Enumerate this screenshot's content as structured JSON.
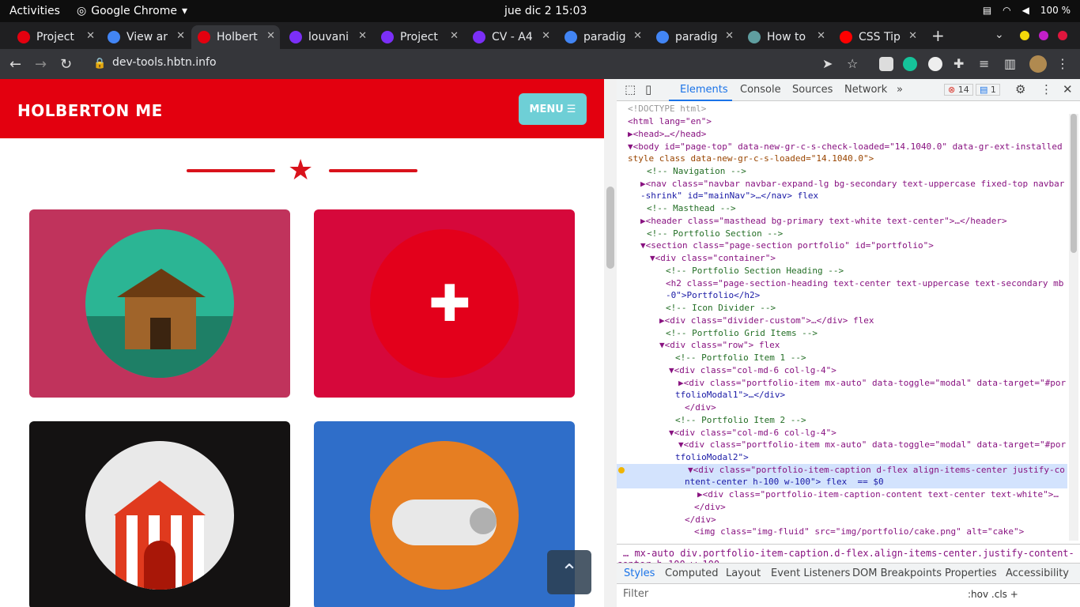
{
  "topbar": {
    "activities": "Activities",
    "app": "Google Chrome",
    "clock": "jue dic 2  15:03",
    "battery": "100 %"
  },
  "tabs": [
    {
      "title": "Project",
      "color": "#e3000f"
    },
    {
      "title": "View ar",
      "color": "#4285f4"
    },
    {
      "title": "Holbert",
      "color": "#e3000f"
    },
    {
      "title": "louvani",
      "color": "#7b2ff7"
    },
    {
      "title": "Project",
      "color": "#7b2ff7"
    },
    {
      "title": "CV - A4",
      "color": "#7b2ff7"
    },
    {
      "title": "paradig",
      "color": "#4285f4"
    },
    {
      "title": "paradig",
      "color": "#4285f4"
    },
    {
      "title": "How to",
      "color": "#5f9ea0"
    },
    {
      "title": "CSS Tip",
      "color": "#ff0000"
    }
  ],
  "browser": {
    "url": "dev-tools.hbtn.info",
    "new_tab": "+"
  },
  "site": {
    "brand": "HOLBERTON ME",
    "menu": "MENU",
    "backtop": "⌃"
  },
  "cards": [
    {
      "name": "cabin",
      "bg": "#c0335c",
      "circle": "#2bb594"
    },
    {
      "name": "cake",
      "bg": "#d6083b",
      "circle": "#e3001b"
    },
    {
      "name": "circus",
      "bg": "#141212",
      "circle": "#e9e9e9"
    },
    {
      "name": "game",
      "bg": "#2f6ec9",
      "circle": "#e67e22"
    }
  ],
  "devtools": {
    "tabs": [
      "Elements",
      "Console",
      "Sources",
      "Network",
      "»"
    ],
    "errors": "14",
    "messages": "1",
    "lines": [
      "<!DOCTYPE html>",
      "<html lang=\"en\">",
      "▶<head>…</head>",
      "▼<body id=\"page-top\" data-new-gr-c-s-check-loaded=\"14.1040.0\" data-gr-ext-installed",
      "style class data-new-gr-c-s-loaded=\"14.1040.0\">",
      "<!-- Navigation -->",
      "▶<nav class=\"navbar navbar-expand-lg bg-secondary text-uppercase fixed-top navbar",
      "-shrink\" id=\"mainNav\">…</nav> flex",
      "<!-- Masthead -->",
      "▶<header class=\"masthead bg-primary text-white text-center\">…</header>",
      "<!-- Portfolio Section -->",
      "▼<section class=\"page-section portfolio\" id=\"portfolio\">",
      "▼<div class=\"container\">",
      "<!-- Portfolio Section Heading -->",
      "<h2 class=\"page-section-heading text-center text-uppercase text-secondary mb",
      "-0\">Portfolio</h2>",
      "<!-- Icon Divider -->",
      "▶<div class=\"divider-custom\">…</div> flex",
      "<!-- Portfolio Grid Items -->",
      "▼<div class=\"row\"> flex",
      "<!-- Portfolio Item 1 -->",
      "▼<div class=\"col-md-6 col-lg-4\">",
      "▶<div class=\"portfolio-item mx-auto\" data-toggle=\"modal\" data-target=\"#por",
      "tfolioModal1\">…</div>",
      "</div>",
      "<!-- Portfolio Item 2 -->",
      "▼<div class=\"col-md-6 col-lg-4\">",
      "▼<div class=\"portfolio-item mx-auto\" data-toggle=\"modal\" data-target=\"#por",
      "tfolioModal2\">",
      "▼<div class=\"portfolio-item-caption d-flex align-items-center justify-co",
      "ntent-center h-100 w-100\"> flex  == $0",
      "▶<div class=\"portfolio-item-caption-content text-center text-white\">…",
      "</div>",
      "</div>",
      "<img class=\"img-fluid\" src=\"img/portfolio/cake.png\" alt=\"cake\">"
    ],
    "crumbs": "…  mx-auto    div.portfolio-item-caption.d-flex.align-items-center.justify-content-center.h-100.w-100",
    "style_tabs": [
      "Styles",
      "Computed",
      "Layout",
      "Event Listeners",
      "DOM Breakpoints",
      "Properties",
      "Accessibility"
    ],
    "filter": "Filter",
    "hov": ":hov  .cls  +"
  }
}
